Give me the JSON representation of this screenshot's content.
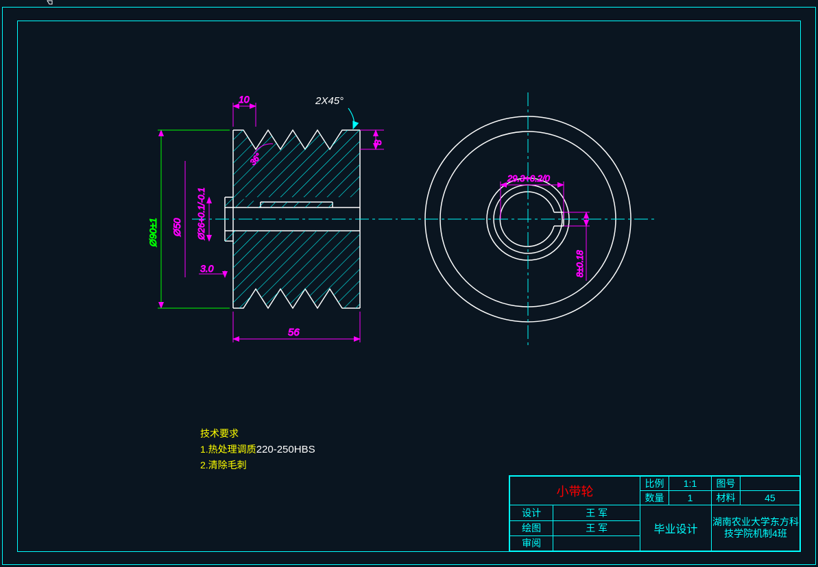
{
  "dimensions": {
    "chamfer_label": "2X45°",
    "top_left": "10",
    "right_small": "8",
    "bottom_width": "56",
    "left_step": "3.0",
    "dia_outer": "Ø90±1",
    "dia_mid": "Ø50",
    "dia_bore": "Ø26+0.1/-0.1",
    "front_key_width": "29.3+0.2/0",
    "front_key_height": "8±0.18",
    "angle": "36°"
  },
  "notes": {
    "heading": "技术要求",
    "line1": "1.热处理调质220-250HBS",
    "line2": "2.清除毛刺"
  },
  "titleblock": {
    "part_name": "小带轮",
    "scale_label": "比例",
    "scale": "1:1",
    "qty_label": "数量",
    "qty": "1",
    "drawing_no_label": "图号",
    "material_label": "材料",
    "material": "45",
    "design_label": "设计",
    "designer": "王 军",
    "draw_label": "绘图",
    "drafter": "王 军",
    "check_label": "审阅",
    "project": "毕业设计",
    "org": "湖南农业大学东方科技学院机制4班"
  }
}
